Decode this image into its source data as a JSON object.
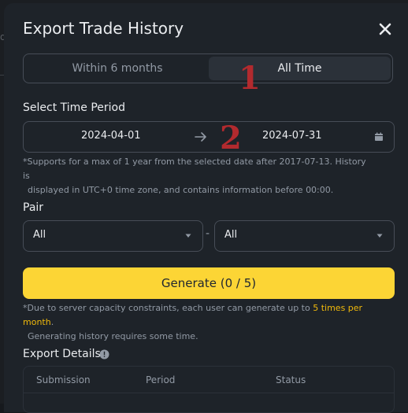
{
  "dialog": {
    "title": "Export Trade History"
  },
  "range_tabs": [
    {
      "label": "Within 6 months",
      "active": false
    },
    {
      "label": "All Time",
      "active": true
    }
  ],
  "time_period": {
    "label": "Select Time Period",
    "start": "2024-04-01",
    "end": "2024-07-31",
    "note_line1": "*Supports for a max of 1 year from the selected date after 2017-07-13. History is",
    "note_line2": "displayed in UTC+0 time zone, and contains information before 00:00."
  },
  "pair": {
    "label": "Pair",
    "base": "All",
    "quote": "All",
    "separator": "-"
  },
  "generate": {
    "label": "Generate (0 / 5)",
    "note_prefix": "*Due to server capacity constraints, each user can generate up to ",
    "note_highlight": "5 times per month",
    "note_suffix": ".",
    "note_line2": "Generating history requires some time."
  },
  "export_details": {
    "label": "Export Details",
    "columns": [
      "Submission",
      "Period",
      "Status"
    ]
  },
  "annotations": [
    "1",
    "2"
  ],
  "colors": {
    "accent": "#fcd535",
    "highlight": "#f0b90b",
    "annotation": "#b22a2e",
    "modal_bg": "#1e2329"
  }
}
